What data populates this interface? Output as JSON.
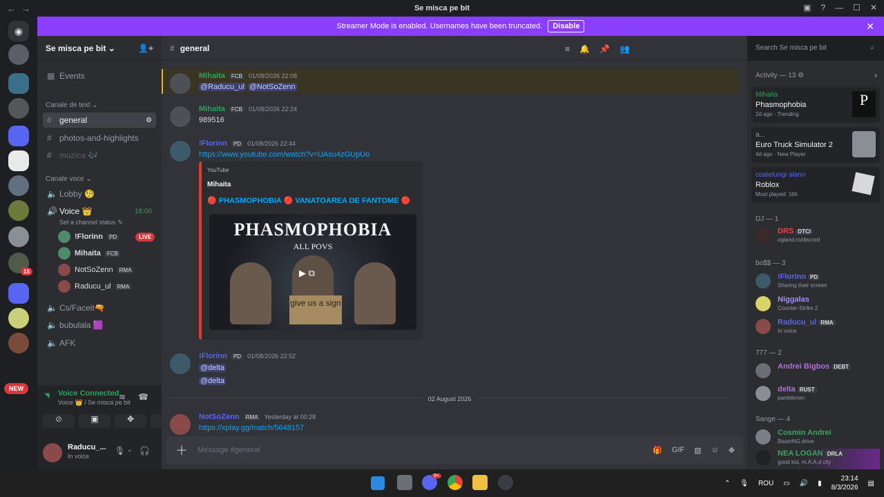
{
  "window": {
    "title": "Se misca pe bit"
  },
  "banner": {
    "text": "Streamer Mode is enabled. Usernames have been truncated.",
    "button": "Disable"
  },
  "guilds": {
    "new_badge": "NEW",
    "unread_count": "15"
  },
  "server": {
    "name": "Se misca pe bit"
  },
  "sidebar": {
    "events": "Events",
    "cat_text": "Canale de text",
    "text_channels": [
      "general",
      "photos-and-highlights",
      "muzica 🎶"
    ],
    "cat_voice": "Canale voce",
    "lobby": "Lobby 🧐",
    "voice": "Voice 👑",
    "voice_time": "18:06",
    "voice_status": "Set a channel status",
    "voice_users": [
      {
        "name": "!Florinn",
        "tag": "PD",
        "live": "LIVE"
      },
      {
        "name": "Mihaita",
        "tag": "FCB"
      },
      {
        "name": "NotSoZenn",
        "tag": "RMA"
      },
      {
        "name": "Raducu_ul",
        "tag": "RMA"
      }
    ],
    "other_voice": [
      "Cs/Faceit🔫",
      "bubulala 🟪",
      "AFK"
    ]
  },
  "voicebar": {
    "status": "Voice Connected",
    "sub": "Voice 👑 / Se misca pe bit"
  },
  "user": {
    "name": "Raducu_...",
    "status": "In voice"
  },
  "channel": {
    "name": "general",
    "input_placeholder": "Message #general"
  },
  "search": {
    "placeholder": "Search Se misca pe bit"
  },
  "messages": [
    {
      "user": "Mihaita",
      "tag": "FCB",
      "time": "01/08/2026 22:08",
      "m1": "@Raducu_ul",
      "m2": "@NotSoZenn"
    },
    {
      "user": "Mihaita",
      "tag": "FCB",
      "time": "01/08/2026 22:24",
      "text": "989516"
    },
    {
      "user": "!Florinn",
      "tag": "PD",
      "time": "01/08/2026 22:44",
      "link": "https://www.youtube.com/watch?v=UAsu4zGUpUo"
    },
    {
      "user": "!Florinn",
      "tag": "PD",
      "time": "01/08/2026 22:52",
      "m1": "@delta",
      "m2": "@delta"
    },
    {
      "user": "NotSoZenn",
      "tag": "RMA",
      "time": "Yesterday at 00:28",
      "link": "https://xplay.gg/match/5648157"
    }
  ],
  "embed": {
    "provider": "YouTube",
    "author": "Mihaita",
    "title": "🔴 PHASMOPHOBIA 🔴 VANATOAREA DE FANTOME 🔴",
    "thumb_title": "PHASMOPHOBIA",
    "thumb_sub": "ALL POVS",
    "sign": "give us a sign"
  },
  "date_divider": "02 August 2026",
  "activity": {
    "header": "Activity — 13",
    "cards": [
      {
        "user": "Mihaita",
        "game": "Phasmophobia",
        "meta": "2d ago",
        "meta2": "Trending"
      },
      {
        "user": "a...",
        "game": "Euro Truck Simulator 2",
        "meta": "4d ago",
        "meta2": "New Player"
      },
      {
        "user": "coaielungi alann",
        "game": "Roblox",
        "meta": "Most played: 16h"
      }
    ],
    "sections": [
      {
        "title": "DJ — 1",
        "members": [
          {
            "name": "DRS",
            "tag": "DTCI",
            "sub": "ogland.ro/discord",
            "color": "#f23f43"
          }
        ]
      },
      {
        "title": "bo$$ — 3",
        "members": [
          {
            "name": "!Florinn",
            "tag": "PD",
            "sub": "Sharing their screen",
            "color": "#5865f2"
          },
          {
            "name": "Niggalas",
            "tag": "",
            "sub": "Counter-Strike 2",
            "color": "#a78bfa"
          },
          {
            "name": "Raducu_ul",
            "tag": "RMA",
            "sub": "In voice",
            "color": "#5865f2"
          }
        ]
      },
      {
        "title": "777 — 2",
        "members": [
          {
            "name": "Andrei Bigbos",
            "tag": "DEBT",
            "sub": "",
            "color": "#b071d6"
          },
          {
            "name": "delta",
            "tag": "RUST",
            "sub": "pantelimon",
            "color": "#b071d6"
          }
        ]
      },
      {
        "title": "Sange — 4",
        "members": [
          {
            "name": "Cosmin Andrei",
            "tag": "",
            "sub": "BeamNG.drive",
            "color": "#3ba55c"
          },
          {
            "name": "NEA LOGAN",
            "tag": "DRLA",
            "sub": "good kid, m.A.A.d city",
            "color": "#3ba55c"
          }
        ]
      }
    ]
  },
  "taskbar": {
    "lang": "ROU",
    "time": "23:14",
    "date": "8/3/2026",
    "discord_badge": "9+"
  },
  "colors": {
    "accent": "#5865f2",
    "banner": "#8a3ffc",
    "live": "#da373c",
    "voice_green": "#23a55a"
  }
}
